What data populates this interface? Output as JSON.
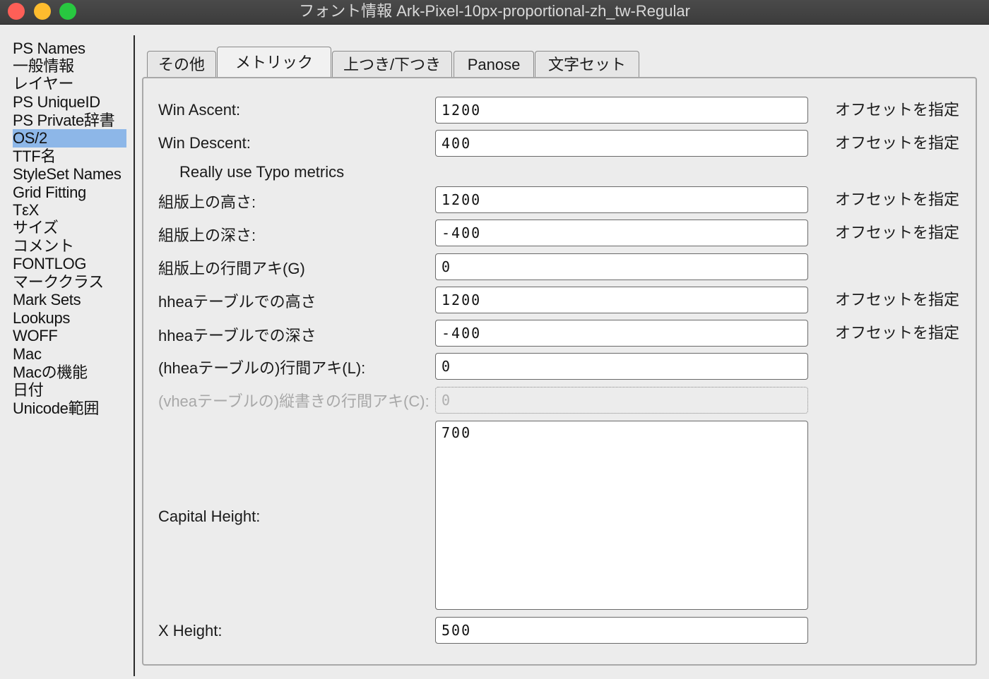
{
  "window": {
    "title": "フォント情報 Ark-Pixel-10px-proportional-zh_tw-Regular"
  },
  "sidebar": {
    "items": [
      {
        "label": "PS Names"
      },
      {
        "label": "一般情報"
      },
      {
        "label": "レイヤー"
      },
      {
        "label": "PS UniqueID"
      },
      {
        "label": "PS Private辞書"
      },
      {
        "label": "OS/2"
      },
      {
        "label": "TTF名"
      },
      {
        "label": "StyleSet Names"
      },
      {
        "label": "Grid Fitting"
      },
      {
        "label": "TεX"
      },
      {
        "label": "サイズ"
      },
      {
        "label": "コメント"
      },
      {
        "label": "FONTLOG"
      },
      {
        "label": "マーククラス"
      },
      {
        "label": "Mark Sets"
      },
      {
        "label": "Lookups"
      },
      {
        "label": "WOFF"
      },
      {
        "label": "Mac"
      },
      {
        "label": "Macの機能"
      },
      {
        "label": "日付"
      },
      {
        "label": "Unicode範囲"
      }
    ],
    "selected": "OS/2",
    "selected_color": "#8db7e8"
  },
  "tabs": [
    {
      "label": "その他"
    },
    {
      "label": "メトリック"
    },
    {
      "label": "上つき/下つき"
    },
    {
      "label": "Panose"
    },
    {
      "label": "文字セット"
    }
  ],
  "active_tab": "メトリック",
  "metrics": {
    "win_ascent": {
      "label": "Win Ascent:",
      "value": "1200",
      "offset_label": "オフセットを指定"
    },
    "win_descent": {
      "label": "Win Descent:",
      "value": "400",
      "offset_label": "オフセットを指定"
    },
    "really_use_typo": {
      "label": "Really use Typo metrics"
    },
    "typo_ascent": {
      "label": "組版上の高さ:",
      "value": "1200",
      "offset_label": "オフセットを指定"
    },
    "typo_descent": {
      "label": "組版上の深さ:",
      "value": "-400",
      "offset_label": "オフセットを指定"
    },
    "typo_line_gap": {
      "label": "組版上の行間アキ(G)",
      "value": "0"
    },
    "hhea_ascent": {
      "label": "hheaテーブルでの高さ",
      "value": "1200",
      "offset_label": "オフセットを指定"
    },
    "hhea_descent": {
      "label": "hheaテーブルでの深さ",
      "value": "-400",
      "offset_label": "オフセットを指定"
    },
    "hhea_line_gap": {
      "label": "(hheaテーブルの)行間アキ(L):",
      "value": "0"
    },
    "vhea_line_gap": {
      "label": "(vheaテーブルの)縦書きの行間アキ(C):",
      "value": "0"
    },
    "capital_height": {
      "label": "Capital Height:",
      "value": "700"
    },
    "x_height": {
      "label": "X Height:",
      "value": "500"
    }
  }
}
